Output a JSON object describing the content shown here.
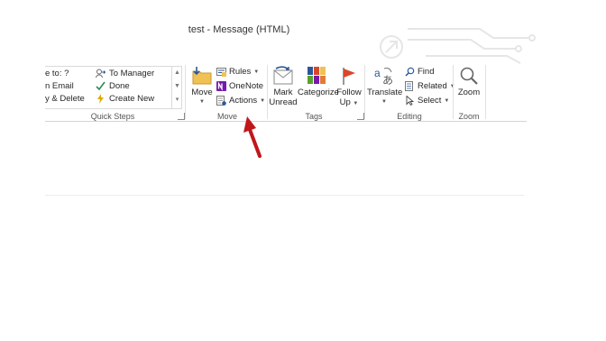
{
  "window": {
    "title": "test  -  Message (HTML)"
  },
  "quick_steps": {
    "items": [
      "e to: ?",
      "n Email",
      "y & Delete",
      "To Manager",
      "Done",
      "Create New"
    ],
    "group_label": "Quick Steps"
  },
  "move": {
    "move_label": "Move",
    "rules_label": "Rules",
    "onenote_label": "OneNote",
    "actions_label": "Actions",
    "group_label": "Move"
  },
  "tags": {
    "mark_unread_line1": "Mark",
    "mark_unread_line2": "Unread",
    "categorize_label": "Categorize",
    "follow_up_line1": "Follow",
    "follow_up_line2": "Up",
    "group_label": "Tags"
  },
  "editing": {
    "translate_label": "Translate",
    "find_label": "Find",
    "related_label": "Related",
    "select_label": "Select",
    "group_label": "Editing"
  },
  "zoom": {
    "zoom_label": "Zoom",
    "group_label": "Zoom"
  },
  "colors": {
    "accent": "#2b579a",
    "arrow": "#c0171b",
    "flag": "#d9472b"
  }
}
